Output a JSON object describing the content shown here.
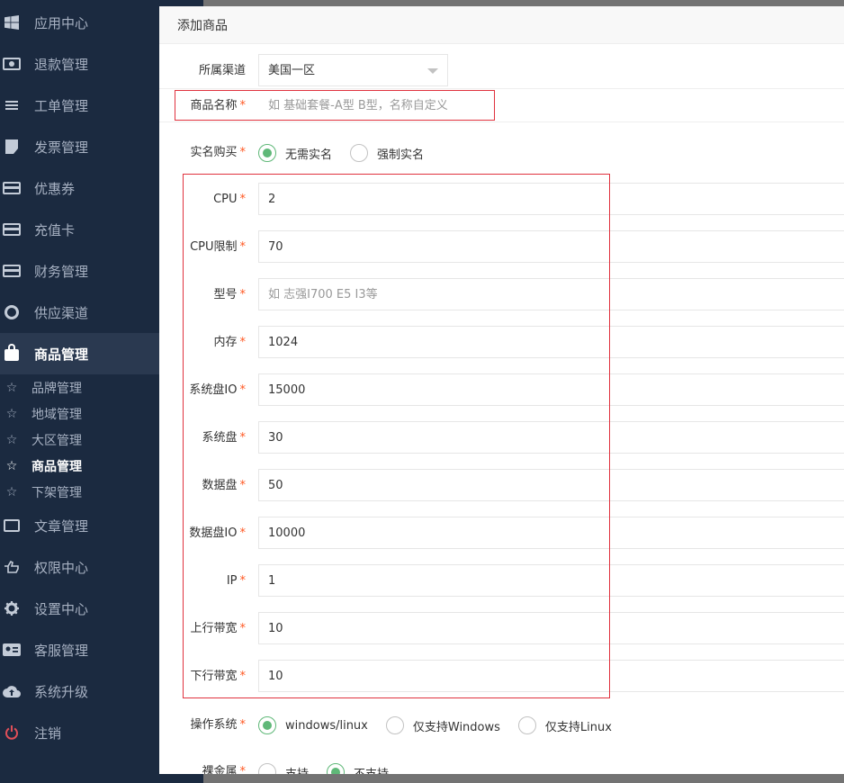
{
  "sidebar": {
    "items": [
      {
        "label": "应用中心",
        "icon": "windows-icon"
      },
      {
        "label": "退款管理",
        "icon": "money-icon"
      },
      {
        "label": "工单管理",
        "icon": "list-icon"
      },
      {
        "label": "发票管理",
        "icon": "invoice-icon"
      },
      {
        "label": "优惠券",
        "icon": "coupon-card-icon"
      },
      {
        "label": "充值卡",
        "icon": "credit-card-icon"
      },
      {
        "label": "财务管理",
        "icon": "finance-card-icon"
      },
      {
        "label": "供应渠道",
        "icon": "lifebuoy-icon"
      },
      {
        "label": "商品管理",
        "icon": "shopping-bag-icon",
        "active": true
      }
    ],
    "sub_items": [
      {
        "label": "品牌管理"
      },
      {
        "label": "地域管理"
      },
      {
        "label": "大区管理"
      },
      {
        "label": "商品管理",
        "active": true
      },
      {
        "label": "下架管理"
      }
    ],
    "items_after": [
      {
        "label": "文章管理",
        "icon": "newspaper-icon"
      },
      {
        "label": "权限中心",
        "icon": "hand-pointer-icon"
      },
      {
        "label": "设置中心",
        "icon": "gear-icon"
      },
      {
        "label": "客服管理",
        "icon": "id-card-icon"
      },
      {
        "label": "系统升级",
        "icon": "cloud-upload-icon"
      },
      {
        "label": "注销",
        "icon": "power-icon"
      }
    ],
    "star_glyph": "☆"
  },
  "dialog": {
    "title": "添加商品",
    "required_mark": "*",
    "channel": {
      "label": "所属渠道",
      "value": "美国一区"
    },
    "product_name": {
      "label": "商品名称",
      "placeholder": "如 基础套餐-A型  B型，名称自定义"
    },
    "real_name": {
      "label": "实名购买",
      "options": [
        "无需实名",
        "强制实名"
      ],
      "selected": 0
    },
    "specs": [
      {
        "label": "CPU",
        "value": "2"
      },
      {
        "label": "CPU限制",
        "value": "70"
      },
      {
        "label": "型号",
        "value": "",
        "placeholder": "如 志强I700  E5  I3等"
      },
      {
        "label": "内存",
        "value": "1024"
      },
      {
        "label": "系统盘IO",
        "value": "15000"
      },
      {
        "label": "系统盘",
        "value": "30"
      },
      {
        "label": "数据盘",
        "value": "50"
      },
      {
        "label": "数据盘IO",
        "value": "10000"
      },
      {
        "label": "IP",
        "value": "1"
      },
      {
        "label": "上行带宽",
        "value": "10"
      },
      {
        "label": "下行带宽",
        "value": "10"
      }
    ],
    "os": {
      "label": "操作系统",
      "options": [
        "windows/linux",
        "仅支持Windows",
        "仅支持Linux"
      ],
      "selected": 0
    },
    "bare_metal": {
      "label": "裸金属",
      "options": [
        "支持",
        "不支持"
      ],
      "selected": 1
    }
  },
  "colors": {
    "sidebar_bg": "#1b2a40",
    "sidebar_active_bg": "#2a3950",
    "accent_green": "#5fb878",
    "required_red": "#ff5722",
    "highlight_red": "#e0323e",
    "logout_red": "#e14f58"
  }
}
